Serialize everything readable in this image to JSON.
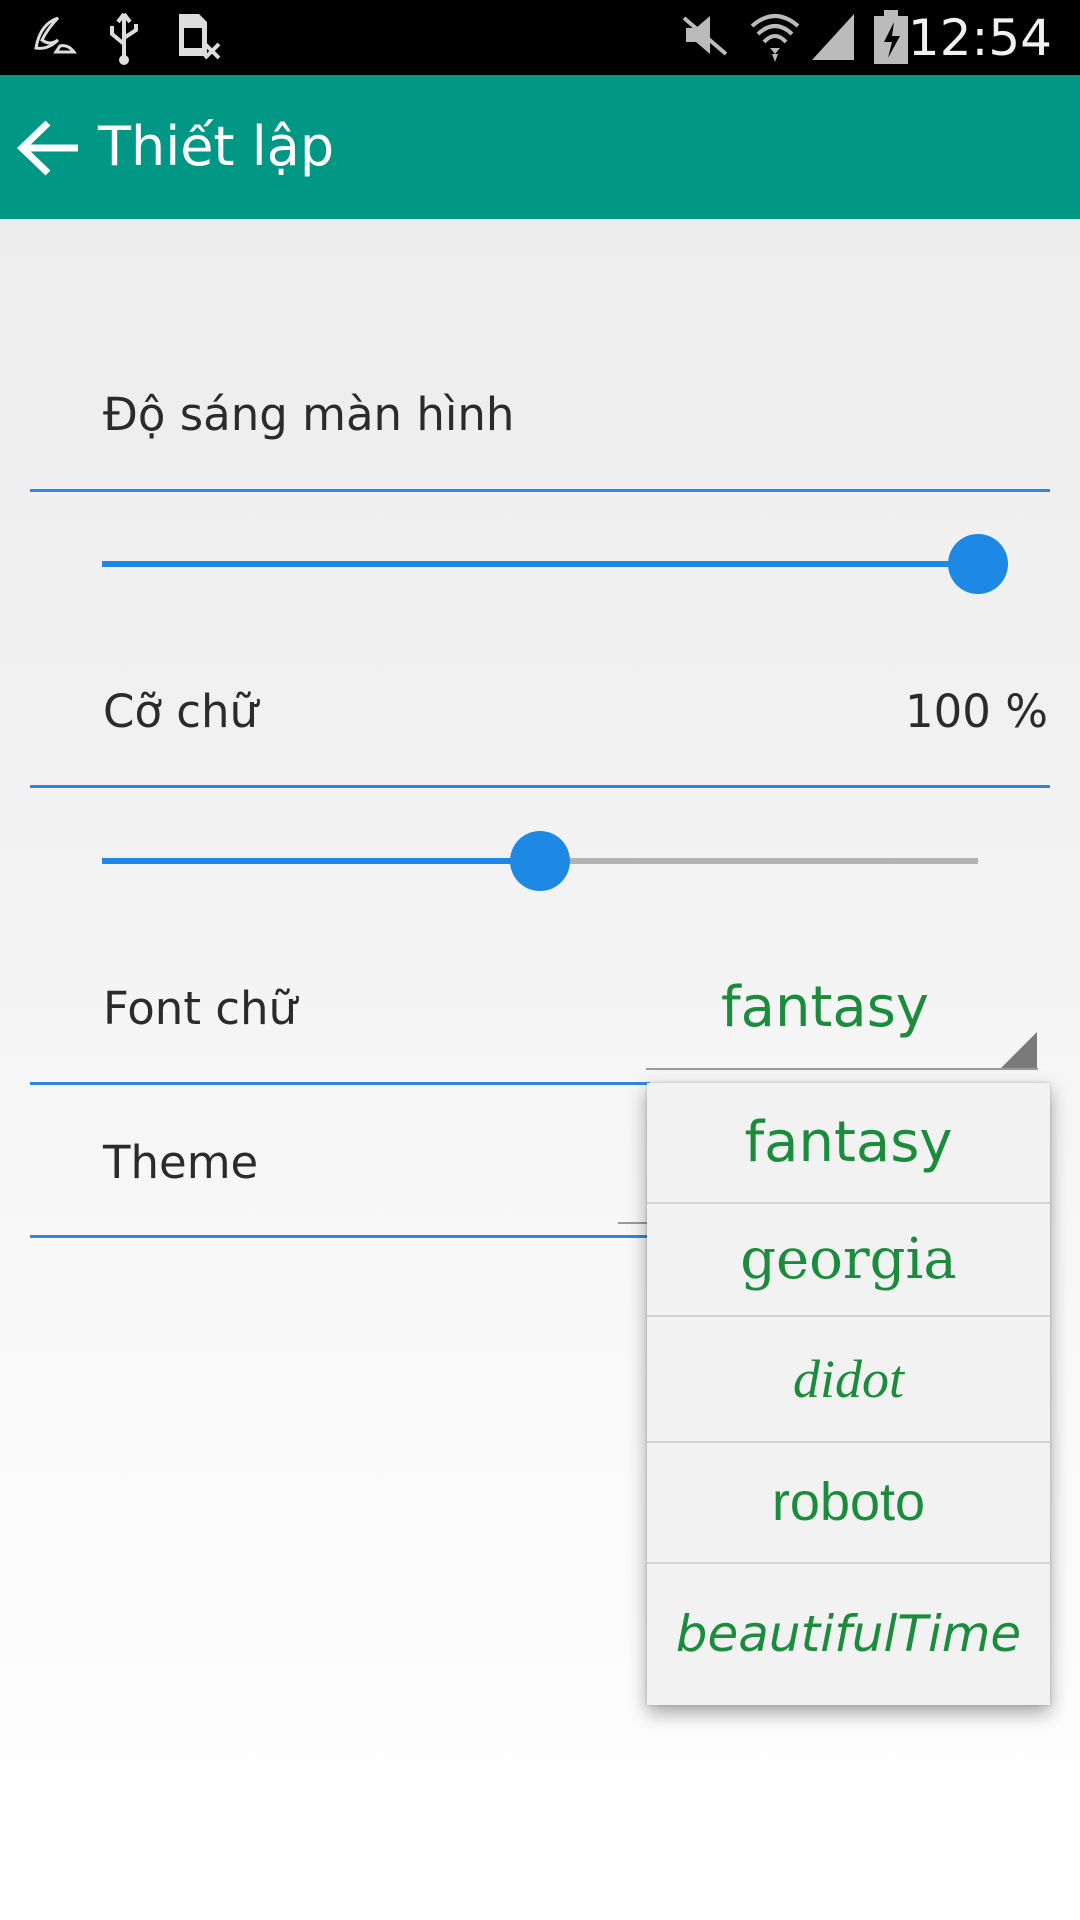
{
  "status_bar": {
    "time": "12:54",
    "icons": [
      "moon-icon",
      "usb-icon",
      "no-sim-icon",
      "mute-icon",
      "wifi-icon",
      "signal-icon",
      "battery-charging-icon"
    ]
  },
  "app_bar": {
    "title": "Thiết lập",
    "back_icon": "arrow-back-icon"
  },
  "settings": {
    "brightness": {
      "label": "Độ sáng màn hình",
      "level": 1.0
    },
    "font_size": {
      "label": "Cỡ chữ",
      "value": "100 %",
      "level": 0.5
    },
    "font": {
      "label": "Font chữ",
      "selected": "fantasy"
    },
    "theme": {
      "label": "Theme"
    }
  },
  "font_dropdown": {
    "options": [
      {
        "label": "fantasy"
      },
      {
        "label": "georgia"
      },
      {
        "label": "didot"
      },
      {
        "label": "roboto"
      },
      {
        "label": "beautifulTime"
      }
    ]
  },
  "colors": {
    "app_bar": "#009885",
    "accent": "#1e88e5",
    "option_text": "#1a8c3c"
  }
}
